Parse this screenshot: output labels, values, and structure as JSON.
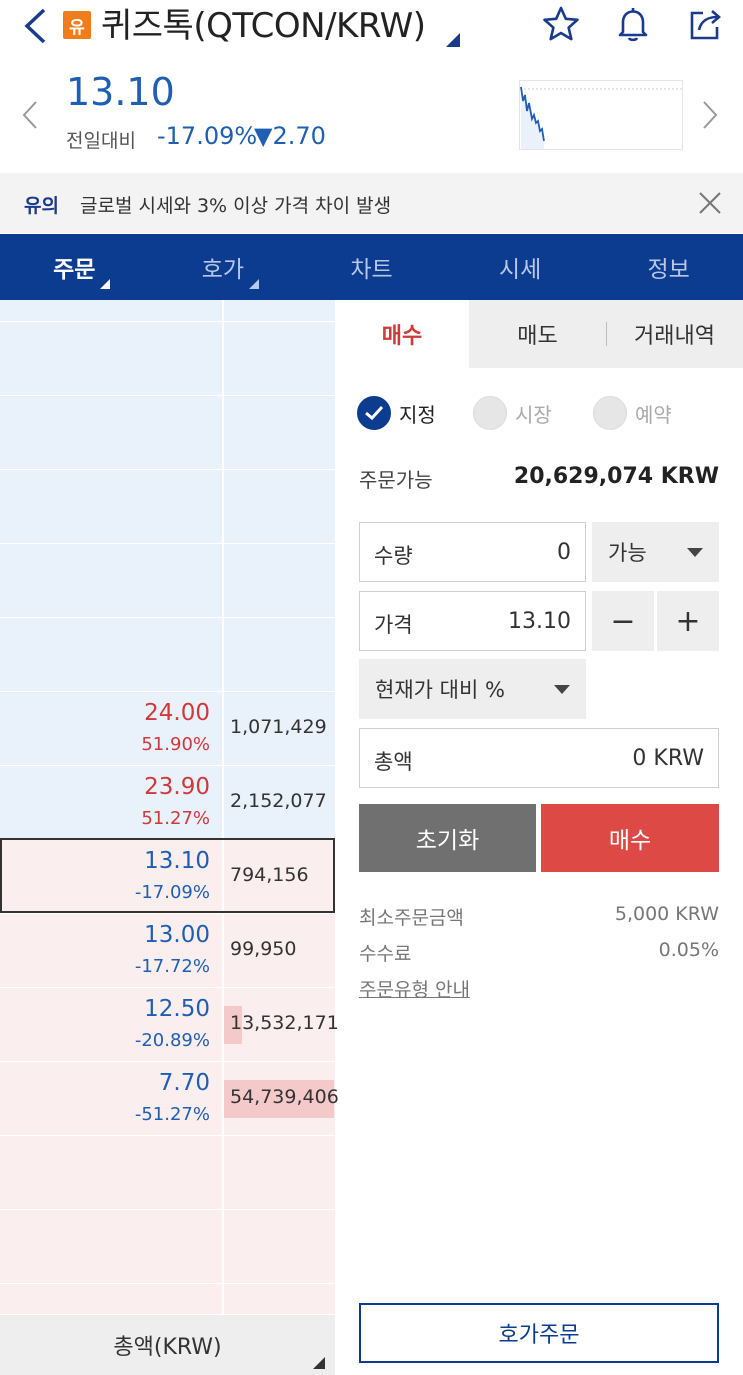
{
  "header": {
    "badge": "유",
    "title": "퀴즈톡(QTCON/KRW)",
    "current_price": "13.10",
    "change_label": "전일대비",
    "change_pct": "-17.09%",
    "change_amt": "▼2.70"
  },
  "notice": {
    "tag": "유의",
    "text": "글로벌 시세와 3% 이상 가격 차이 발생"
  },
  "tabs": [
    {
      "label": "주문"
    },
    {
      "label": "호가"
    },
    {
      "label": "차트"
    },
    {
      "label": "시세"
    },
    {
      "label": "정보"
    }
  ],
  "orderbook": {
    "asks": [
      {
        "price": "24.00",
        "pct": "51.90%",
        "volume": "1,071,429"
      },
      {
        "price": "23.90",
        "pct": "51.27%",
        "volume": "2,152,077"
      }
    ],
    "bids": [
      {
        "price": "13.10",
        "pct": "-17.09%",
        "volume": "794,156",
        "bar": 0
      },
      {
        "price": "13.00",
        "pct": "-17.72%",
        "volume": "99,950",
        "bar": 0
      },
      {
        "price": "12.50",
        "pct": "-20.89%",
        "volume": "13,532,171",
        "bar": 0.16
      },
      {
        "price": "7.70",
        "pct": "-51.27%",
        "volume": "54,739,406",
        "bar": 1.0
      }
    ],
    "footer_label": "총액(KRW)"
  },
  "order": {
    "tabs": [
      "매수",
      "매도",
      "거래내역"
    ],
    "types": [
      "지정",
      "시장",
      "예약"
    ],
    "available_label": "주문가능",
    "available_value": "20,629,074 KRW",
    "quantity_label": "수량",
    "quantity_value": "0",
    "quantity_option": "가능",
    "price_label": "가격",
    "price_value": "13.10",
    "minus": "−",
    "plus": "+",
    "pct_select": "현재가 대비 %",
    "total_label": "총액",
    "total_value": "0 KRW",
    "reset_label": "초기화",
    "buy_label": "매수",
    "min_order_label": "최소주문금액",
    "min_order_value": "5,000 KRW",
    "fee_label": "수수료",
    "fee_value": "0.05%",
    "guide_link": "주문유형 안내",
    "quote_order_label": "호가주문"
  },
  "colors": {
    "brand_blue": "#0c3c8f",
    "price_blue": "#1f5fb3",
    "price_red": "#d0383a",
    "buy_red": "#dd4a45"
  }
}
